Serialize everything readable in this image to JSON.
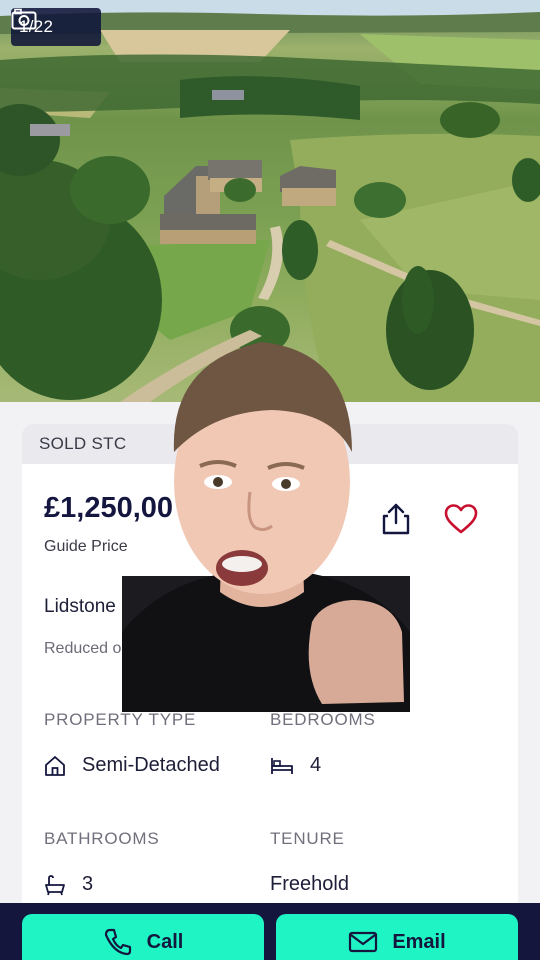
{
  "gallery": {
    "counter": "1/22",
    "icon": "camera-icon"
  },
  "listing": {
    "status": "SOLD STC",
    "price": "£1,250,00",
    "price_qualifier": "Guide Price",
    "address": "Lidstone",
    "reduced_note": "Reduced o",
    "share_icon": "share-icon",
    "favourite_icon": "heart-icon",
    "favourite_color": "#c8102e"
  },
  "details": {
    "property_type_label": "PROPERTY TYPE",
    "property_type_value": "Semi-Detached",
    "bedrooms_label": "BEDROOMS",
    "bedrooms_value": "4",
    "bathrooms_label": "BATHROOMS",
    "bathrooms_value": "3",
    "tenure_label": "TENURE",
    "tenure_value": "Freehold"
  },
  "actions": {
    "call_label": "Call",
    "email_label": "Email",
    "accent_color": "#1ff5c4",
    "bar_color": "#14163e"
  }
}
